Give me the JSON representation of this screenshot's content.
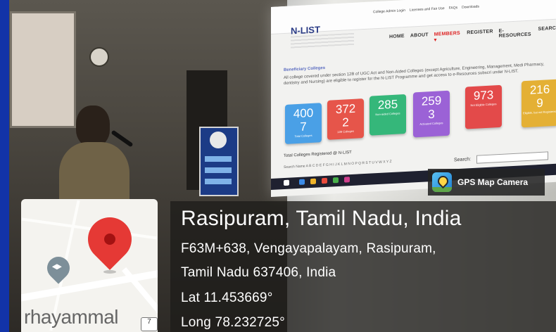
{
  "slide": {
    "brand": "N-LIST",
    "top_links": [
      "College Admin Login",
      "Licenses and Fair Use",
      "FAQs",
      "Downloads"
    ],
    "nav": [
      "HOME",
      "ABOUT",
      "MEMBERS ▾",
      "REGISTER",
      "E-RESOURCES",
      "SEARC"
    ],
    "section_title": "Beneficiary Colleges",
    "description": "All college covered under section 12B of UGC Act and Non-Aided Colleges (except Agriculture, Engineering, Management, Medi Pharmacy, dentistry and Nursing) are eligible to register for the N-LIST Programme and get access to e-Resources subscri under N-LIST.",
    "cards": [
      {
        "value": "400\n7",
        "label": "Total Colleges",
        "color": "#4aa0e6"
      },
      {
        "value": "372\n2",
        "label": "12B Colleges",
        "color": "#e6554a"
      },
      {
        "value": "285",
        "label": "Non-aided Colleges",
        "color": "#35b77a"
      },
      {
        "value": "259\n3",
        "label": "Activated Colleges",
        "color": "#9b62d6"
      },
      {
        "value": "973",
        "label": "Not Eligible Colleges",
        "color": "#e34a4a"
      },
      {
        "value": "216\n9",
        "label": "Eligible, but not Registered",
        "color": "#e4b035"
      }
    ],
    "table_title": "Total Colleges Registered @ N-LIST",
    "alphabet": "Search Name A B C D E F G H I J K L M N O P Q R S T U V W X Y Z",
    "search_label": "Search:"
  },
  "gps": {
    "button_label": "GPS Map Camera",
    "title": "Rasipuram, Tamil Nadu, India",
    "address_line1": "F63M+638, Vengayapalayam, Rasipuram,",
    "address_line2": "Tamil Nadu 637406, India",
    "lat": "Lat 11.453669°",
    "long": "Long 78.232725°",
    "map_label": "rhayammal",
    "road_number": "7"
  },
  "colors": {
    "pin_red": "#e53935",
    "edge_blue": "#1233a8"
  }
}
